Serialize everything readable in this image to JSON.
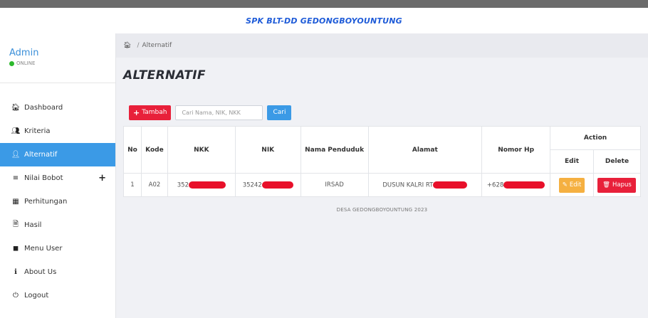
{
  "header": {
    "title": "SPK BLT-DD GEDONGBOYOUNTUNG"
  },
  "user": {
    "name": "Admin",
    "status": "ONLINE",
    "status_color": "#2db92d"
  },
  "sidebar": {
    "items": [
      {
        "label": "Dashboard",
        "icon": "home-icon",
        "glyph": "🏠︎"
      },
      {
        "label": "Kriteria",
        "icon": "users-icon",
        "glyph": "👥︎"
      },
      {
        "label": "Alternatif",
        "icon": "user-icon",
        "glyph": "👤︎",
        "active": true
      },
      {
        "label": "Nilai Bobot",
        "icon": "list-icon",
        "glyph": "≡",
        "expand": "+"
      },
      {
        "label": "Perhitungan",
        "icon": "calculator-icon",
        "glyph": "▦"
      },
      {
        "label": "Hasil",
        "icon": "file-icon",
        "glyph": "🗎︎"
      },
      {
        "label": "Menu User",
        "icon": "user-square-icon",
        "glyph": "◼"
      },
      {
        "label": "About Us",
        "icon": "info-icon",
        "glyph": "ℹ"
      },
      {
        "label": "Logout",
        "icon": "power-icon",
        "glyph": "⏻"
      }
    ]
  },
  "breadcrumb": {
    "current": "Alternatif"
  },
  "page": {
    "title": "ALTERNATIF"
  },
  "toolbar": {
    "add_label": "Tambah",
    "search_placeholder": "Cari Nama, NIK, NKK",
    "search_button": "Cari"
  },
  "table": {
    "headers": {
      "no": "No",
      "kode": "Kode",
      "nkk": "NKK",
      "nik": "NIK",
      "nama": "Nama Penduduk",
      "alamat": "Alamat",
      "hp": "Nomor Hp",
      "action": "Action",
      "edit": "Edit",
      "delete": "Delete"
    },
    "rows": [
      {
        "no": "1",
        "kode": "A02",
        "nkk": "352",
        "nik": "35242",
        "nama": "IRSAD",
        "alamat": "DUSUN KALRI RT",
        "hp": "+628",
        "edit_label": "Edit",
        "hapus_label": "Hapus"
      }
    ]
  },
  "footer": {
    "text": "DESA GEDONGBOYOUNTUNG 2023"
  },
  "colors": {
    "primary": "#3b9ae6",
    "danger": "#e8203a",
    "warning": "#f5b041"
  }
}
